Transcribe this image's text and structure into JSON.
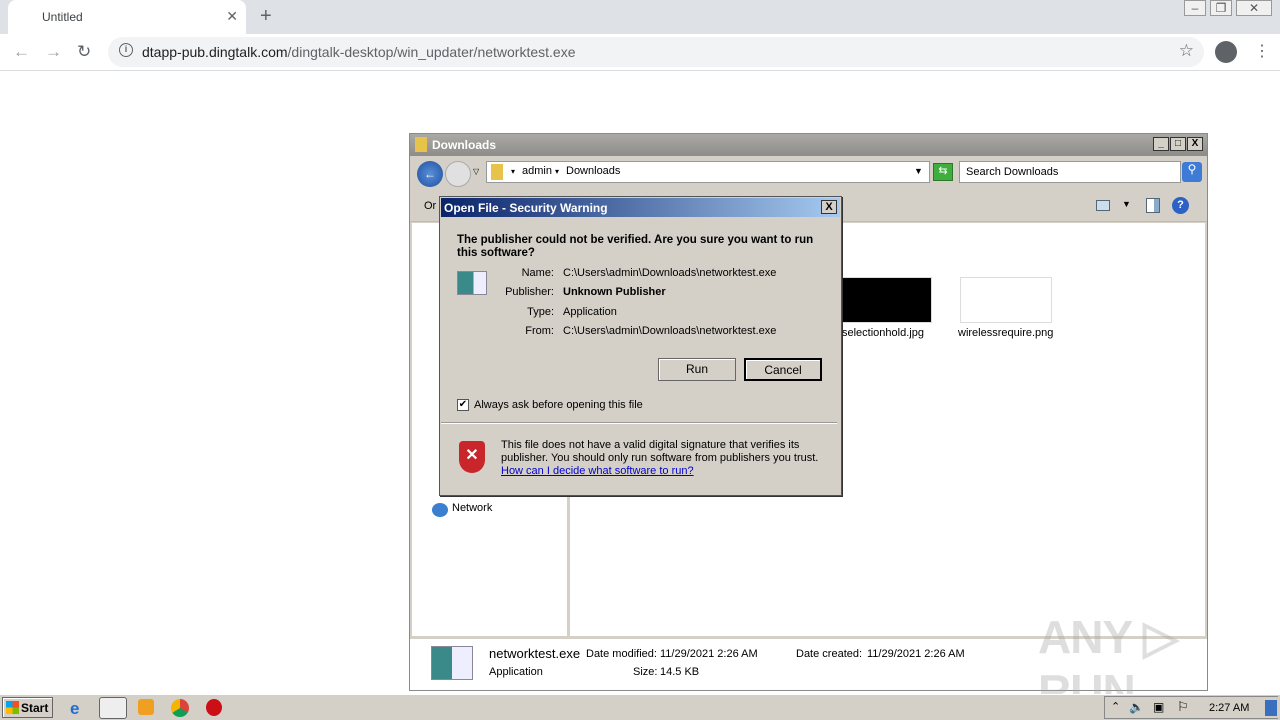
{
  "browser": {
    "tab_title": "Untitled",
    "url_host": "dtapp-pub.dingtalk.com",
    "url_path": "/dingtalk-desktop/win_updater/networktest.exe"
  },
  "explorer": {
    "title": "Downloads",
    "breadcrumb": [
      "admin",
      "Downloads"
    ],
    "search_placeholder": "Search Downloads",
    "toolbar_partial": "Or",
    "nav_items": [
      {
        "label": "Network"
      }
    ],
    "files": [
      {
        "name": "selectionhold.jpg"
      },
      {
        "name": "wirelessrequire.png"
      }
    ],
    "details": {
      "name": "networktest.exe",
      "type": "Application",
      "date_modified_label": "Date modified:",
      "date_modified": "11/29/2021 2:26 AM",
      "size_label": "Size:",
      "size": "14.5 KB",
      "date_created_label": "Date created:",
      "date_created": "11/29/2021 2:26 AM"
    }
  },
  "dialog": {
    "title": "Open File - Security Warning",
    "heading": "The publisher could not be verified.  Are you sure you want to run this software?",
    "fields": [
      {
        "label": "Name:",
        "value": "C:\\Users\\admin\\Downloads\\networktest.exe"
      },
      {
        "label": "Publisher:",
        "value": "Unknown Publisher"
      },
      {
        "label": "Type:",
        "value": "Application"
      },
      {
        "label": "From:",
        "value": "C:\\Users\\admin\\Downloads\\networktest.exe"
      }
    ],
    "run_label": "Run",
    "cancel_label": "Cancel",
    "checkbox_label": "Always ask before opening this file",
    "checkbox_checked": true,
    "warning_text": "This file does not have a valid digital signature that verifies its publisher.  You should only run software from publishers you trust.",
    "help_link": "How can I decide what software to run?"
  },
  "taskbar": {
    "start_label": "Start",
    "clock": "2:27 AM"
  },
  "watermark": "ANY RUN"
}
